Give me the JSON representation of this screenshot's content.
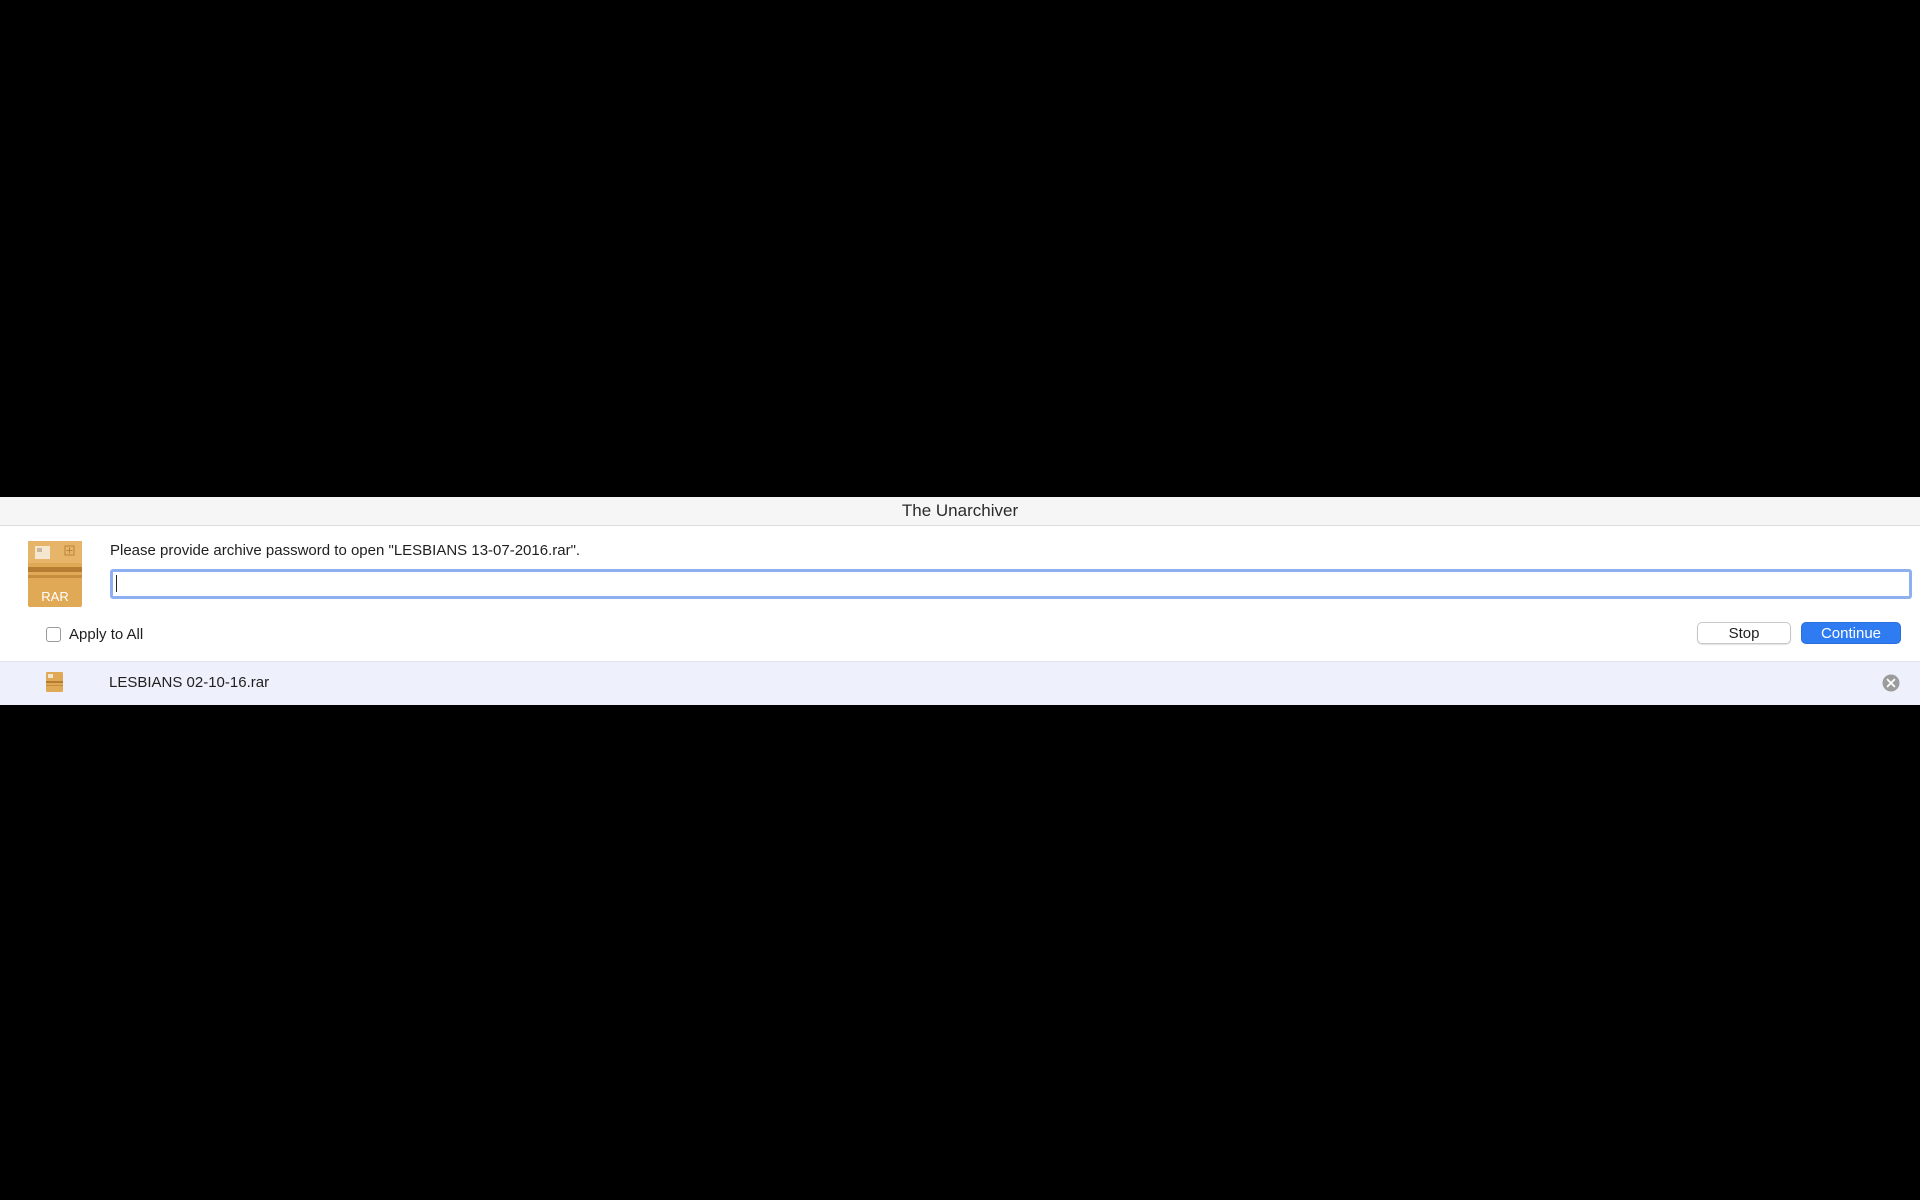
{
  "window": {
    "title": "The Unarchiver"
  },
  "dialog": {
    "archive_icon_label": "RAR",
    "prompt": "Please provide archive password to open \"LESBIANS 13-07-2016.rar\".",
    "password_value": "",
    "apply_all_label": "Apply to All",
    "apply_all_checked": false,
    "stop_label": "Stop",
    "continue_label": "Continue"
  },
  "queue": {
    "items": [
      {
        "file_name": "LESBIANS 02-10-16.rar",
        "icon": "rar-archive-icon"
      }
    ]
  },
  "icons": {
    "archive": "rar-archive-icon",
    "remove": "close-circle-icon"
  },
  "colors": {
    "accent": "#2f7bf2",
    "focus_ring": "#8fb0f0",
    "archive_tan": "#e0a955",
    "row_highlight": "#eef1fb",
    "background": "#000000"
  }
}
